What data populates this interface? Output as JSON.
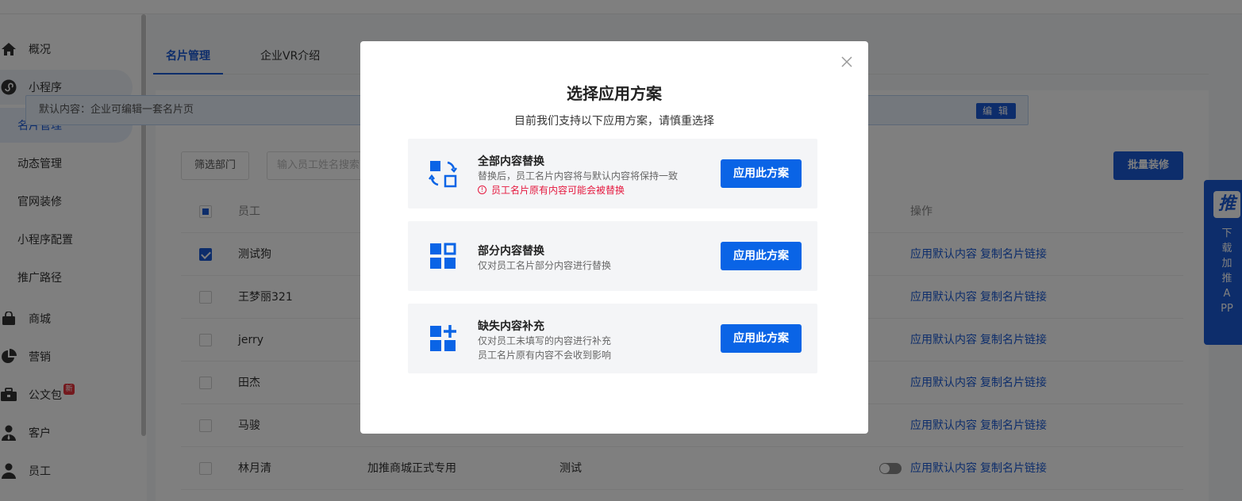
{
  "sidebar": {
    "items": [
      {
        "label": "概况",
        "icon": "home-icon"
      },
      {
        "label": "小程序",
        "icon": "miniprogram-icon"
      },
      {
        "label": "名片管理"
      },
      {
        "label": "动态管理"
      },
      {
        "label": "官网装修"
      },
      {
        "label": "小程序配置"
      },
      {
        "label": "推广路径"
      },
      {
        "label": "商城",
        "icon": "shopping-bag-icon"
      },
      {
        "label": "营销",
        "icon": "pie-chart-icon"
      },
      {
        "label": "公文包",
        "icon": "briefcase-icon",
        "badge": "新"
      },
      {
        "label": "客户",
        "icon": "customer-icon"
      },
      {
        "label": "员工",
        "icon": "user-icon"
      }
    ]
  },
  "tabs": [
    {
      "label": "名片管理",
      "active": true
    },
    {
      "label": "企业VR介绍",
      "active": false
    }
  ],
  "notice": {
    "text": "默认内容：企业可编辑一套名片页",
    "edit_label": "编 辑"
  },
  "toolbar": {
    "filter_label": "筛选部门",
    "search_placeholder": "输入员工姓名搜索",
    "batch_label": "批量装修"
  },
  "table": {
    "headers": {
      "employee": "员工",
      "actions": "操作"
    },
    "rows": [
      {
        "name": "测试狗",
        "checked": true,
        "dept": "",
        "role": "",
        "toggle": false
      },
      {
        "name": "王梦丽321",
        "checked": false,
        "dept": "",
        "role": "",
        "toggle": false
      },
      {
        "name": "jerry",
        "checked": false,
        "dept": "",
        "role": "",
        "toggle": false
      },
      {
        "name": "田杰",
        "checked": false,
        "dept": "",
        "role": "",
        "toggle": false
      },
      {
        "name": "马骏",
        "checked": false,
        "dept": "",
        "role": "",
        "toggle": false
      },
      {
        "name": "林月清",
        "checked": false,
        "dept": "加推商城正式专用",
        "role": "测试",
        "toggle": true
      }
    ],
    "action_apply": "应用默认内容",
    "action_copy": "复制名片链接"
  },
  "app_float": {
    "logo": "推",
    "text": "下载加推APP"
  },
  "modal": {
    "title": "选择应用方案",
    "subtitle": "目前我们支持以下应用方案，请慎重选择",
    "close_icon": "close-icon",
    "options": [
      {
        "title": "全部内容替换",
        "desc": "替换后，员工名片内容将与默认内容将保持一致",
        "warning": "员工名片原有内容可能会被替换",
        "button": "应用此方案",
        "icon": "replace-all-icon"
      },
      {
        "title": "部分内容替换",
        "desc": "仅对员工名片部分内容进行替换",
        "button": "应用此方案",
        "icon": "replace-part-icon"
      },
      {
        "title": "缺失内容补充",
        "desc": "仅对员工未填写的内容进行补充",
        "desc2": "员工名片原有内容不会收到影响",
        "button": "应用此方案",
        "icon": "supplement-icon"
      }
    ]
  },
  "colors": {
    "accent": "#1a5bd6",
    "button": "#0a64e6",
    "warning": "#e5193f"
  }
}
